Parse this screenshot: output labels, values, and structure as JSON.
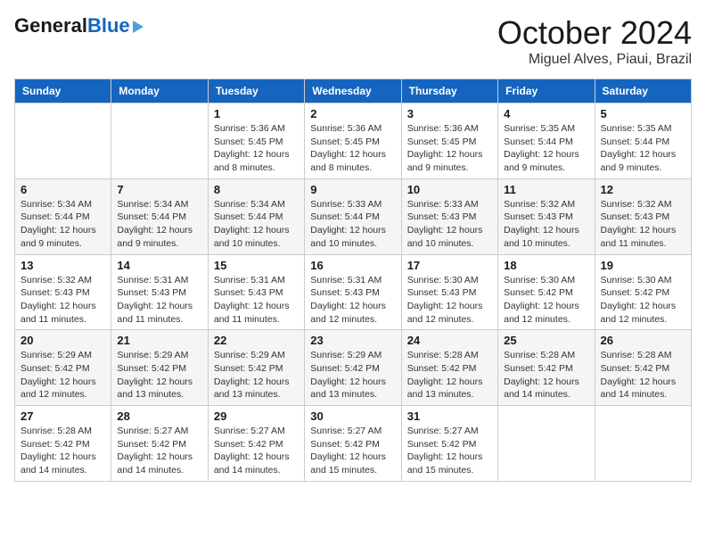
{
  "header": {
    "logo_general": "General",
    "logo_blue": "Blue",
    "month_title": "October 2024",
    "location": "Miguel Alves, Piaui, Brazil"
  },
  "weekdays": [
    "Sunday",
    "Monday",
    "Tuesday",
    "Wednesday",
    "Thursday",
    "Friday",
    "Saturday"
  ],
  "weeks": [
    [
      {
        "day": "",
        "sunrise": "",
        "sunset": "",
        "daylight": ""
      },
      {
        "day": "",
        "sunrise": "",
        "sunset": "",
        "daylight": ""
      },
      {
        "day": "1",
        "sunrise": "Sunrise: 5:36 AM",
        "sunset": "Sunset: 5:45 PM",
        "daylight": "Daylight: 12 hours and 8 minutes."
      },
      {
        "day": "2",
        "sunrise": "Sunrise: 5:36 AM",
        "sunset": "Sunset: 5:45 PM",
        "daylight": "Daylight: 12 hours and 8 minutes."
      },
      {
        "day": "3",
        "sunrise": "Sunrise: 5:36 AM",
        "sunset": "Sunset: 5:45 PM",
        "daylight": "Daylight: 12 hours and 9 minutes."
      },
      {
        "day": "4",
        "sunrise": "Sunrise: 5:35 AM",
        "sunset": "Sunset: 5:44 PM",
        "daylight": "Daylight: 12 hours and 9 minutes."
      },
      {
        "day": "5",
        "sunrise": "Sunrise: 5:35 AM",
        "sunset": "Sunset: 5:44 PM",
        "daylight": "Daylight: 12 hours and 9 minutes."
      }
    ],
    [
      {
        "day": "6",
        "sunrise": "Sunrise: 5:34 AM",
        "sunset": "Sunset: 5:44 PM",
        "daylight": "Daylight: 12 hours and 9 minutes."
      },
      {
        "day": "7",
        "sunrise": "Sunrise: 5:34 AM",
        "sunset": "Sunset: 5:44 PM",
        "daylight": "Daylight: 12 hours and 9 minutes."
      },
      {
        "day": "8",
        "sunrise": "Sunrise: 5:34 AM",
        "sunset": "Sunset: 5:44 PM",
        "daylight": "Daylight: 12 hours and 10 minutes."
      },
      {
        "day": "9",
        "sunrise": "Sunrise: 5:33 AM",
        "sunset": "Sunset: 5:44 PM",
        "daylight": "Daylight: 12 hours and 10 minutes."
      },
      {
        "day": "10",
        "sunrise": "Sunrise: 5:33 AM",
        "sunset": "Sunset: 5:43 PM",
        "daylight": "Daylight: 12 hours and 10 minutes."
      },
      {
        "day": "11",
        "sunrise": "Sunrise: 5:32 AM",
        "sunset": "Sunset: 5:43 PM",
        "daylight": "Daylight: 12 hours and 10 minutes."
      },
      {
        "day": "12",
        "sunrise": "Sunrise: 5:32 AM",
        "sunset": "Sunset: 5:43 PM",
        "daylight": "Daylight: 12 hours and 11 minutes."
      }
    ],
    [
      {
        "day": "13",
        "sunrise": "Sunrise: 5:32 AM",
        "sunset": "Sunset: 5:43 PM",
        "daylight": "Daylight: 12 hours and 11 minutes."
      },
      {
        "day": "14",
        "sunrise": "Sunrise: 5:31 AM",
        "sunset": "Sunset: 5:43 PM",
        "daylight": "Daylight: 12 hours and 11 minutes."
      },
      {
        "day": "15",
        "sunrise": "Sunrise: 5:31 AM",
        "sunset": "Sunset: 5:43 PM",
        "daylight": "Daylight: 12 hours and 11 minutes."
      },
      {
        "day": "16",
        "sunrise": "Sunrise: 5:31 AM",
        "sunset": "Sunset: 5:43 PM",
        "daylight": "Daylight: 12 hours and 12 minutes."
      },
      {
        "day": "17",
        "sunrise": "Sunrise: 5:30 AM",
        "sunset": "Sunset: 5:43 PM",
        "daylight": "Daylight: 12 hours and 12 minutes."
      },
      {
        "day": "18",
        "sunrise": "Sunrise: 5:30 AM",
        "sunset": "Sunset: 5:42 PM",
        "daylight": "Daylight: 12 hours and 12 minutes."
      },
      {
        "day": "19",
        "sunrise": "Sunrise: 5:30 AM",
        "sunset": "Sunset: 5:42 PM",
        "daylight": "Daylight: 12 hours and 12 minutes."
      }
    ],
    [
      {
        "day": "20",
        "sunrise": "Sunrise: 5:29 AM",
        "sunset": "Sunset: 5:42 PM",
        "daylight": "Daylight: 12 hours and 12 minutes."
      },
      {
        "day": "21",
        "sunrise": "Sunrise: 5:29 AM",
        "sunset": "Sunset: 5:42 PM",
        "daylight": "Daylight: 12 hours and 13 minutes."
      },
      {
        "day": "22",
        "sunrise": "Sunrise: 5:29 AM",
        "sunset": "Sunset: 5:42 PM",
        "daylight": "Daylight: 12 hours and 13 minutes."
      },
      {
        "day": "23",
        "sunrise": "Sunrise: 5:29 AM",
        "sunset": "Sunset: 5:42 PM",
        "daylight": "Daylight: 12 hours and 13 minutes."
      },
      {
        "day": "24",
        "sunrise": "Sunrise: 5:28 AM",
        "sunset": "Sunset: 5:42 PM",
        "daylight": "Daylight: 12 hours and 13 minutes."
      },
      {
        "day": "25",
        "sunrise": "Sunrise: 5:28 AM",
        "sunset": "Sunset: 5:42 PM",
        "daylight": "Daylight: 12 hours and 14 minutes."
      },
      {
        "day": "26",
        "sunrise": "Sunrise: 5:28 AM",
        "sunset": "Sunset: 5:42 PM",
        "daylight": "Daylight: 12 hours and 14 minutes."
      }
    ],
    [
      {
        "day": "27",
        "sunrise": "Sunrise: 5:28 AM",
        "sunset": "Sunset: 5:42 PM",
        "daylight": "Daylight: 12 hours and 14 minutes."
      },
      {
        "day": "28",
        "sunrise": "Sunrise: 5:27 AM",
        "sunset": "Sunset: 5:42 PM",
        "daylight": "Daylight: 12 hours and 14 minutes."
      },
      {
        "day": "29",
        "sunrise": "Sunrise: 5:27 AM",
        "sunset": "Sunset: 5:42 PM",
        "daylight": "Daylight: 12 hours and 14 minutes."
      },
      {
        "day": "30",
        "sunrise": "Sunrise: 5:27 AM",
        "sunset": "Sunset: 5:42 PM",
        "daylight": "Daylight: 12 hours and 15 minutes."
      },
      {
        "day": "31",
        "sunrise": "Sunrise: 5:27 AM",
        "sunset": "Sunset: 5:42 PM",
        "daylight": "Daylight: 12 hours and 15 minutes."
      },
      {
        "day": "",
        "sunrise": "",
        "sunset": "",
        "daylight": ""
      },
      {
        "day": "",
        "sunrise": "",
        "sunset": "",
        "daylight": ""
      }
    ]
  ]
}
